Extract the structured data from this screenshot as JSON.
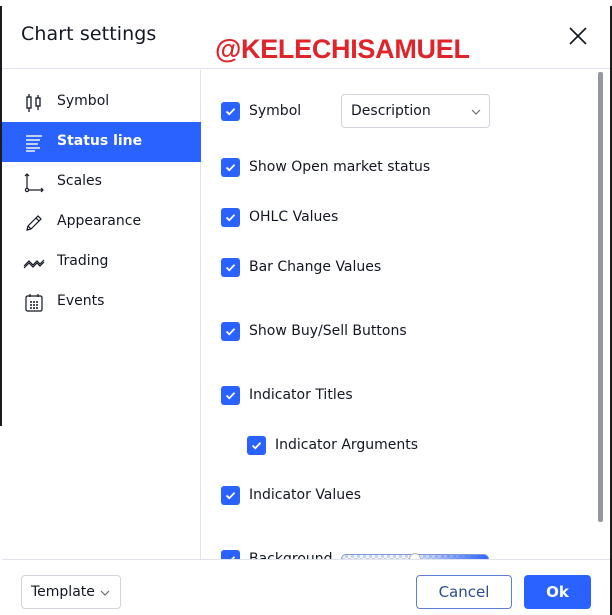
{
  "dialog": {
    "title": "Chart settings",
    "watermark": "@KELECHISAMUEL",
    "close_icon": "close-icon"
  },
  "sidebar": {
    "items": [
      {
        "label": "Symbol",
        "icon": "candlestick-icon",
        "active": false
      },
      {
        "label": "Status line",
        "icon": "status-line-icon",
        "active": true
      },
      {
        "label": "Scales",
        "icon": "scales-axis-icon",
        "active": false
      },
      {
        "label": "Appearance",
        "icon": "pencil-icon",
        "active": false
      },
      {
        "label": "Trading",
        "icon": "trading-zigzag-icon",
        "active": false
      },
      {
        "label": "Events",
        "icon": "calendar-icon",
        "active": false
      }
    ]
  },
  "status_line": {
    "symbol": {
      "label": "Symbol",
      "checked": true,
      "select_value": "Description"
    },
    "options": [
      {
        "label": "Show Open market status",
        "checked": true
      },
      {
        "label": "OHLC Values",
        "checked": true
      },
      {
        "label": "Bar Change Values",
        "checked": true
      },
      {
        "label": "Show Buy/Sell Buttons",
        "checked": true
      },
      {
        "label": "Indicator Titles",
        "checked": true
      },
      {
        "label": "Indicator Arguments",
        "checked": true,
        "indented": true
      },
      {
        "label": "Indicator Values",
        "checked": true
      },
      {
        "label": "Background",
        "checked": true,
        "opacity_percent": 50
      }
    ]
  },
  "footer": {
    "template_label": "Template",
    "cancel_label": "Cancel",
    "ok_label": "Ok"
  },
  "colors": {
    "accent": "#2962ff",
    "watermark": "#e0242c",
    "text": "#131722",
    "border": "#e0e3eb"
  }
}
